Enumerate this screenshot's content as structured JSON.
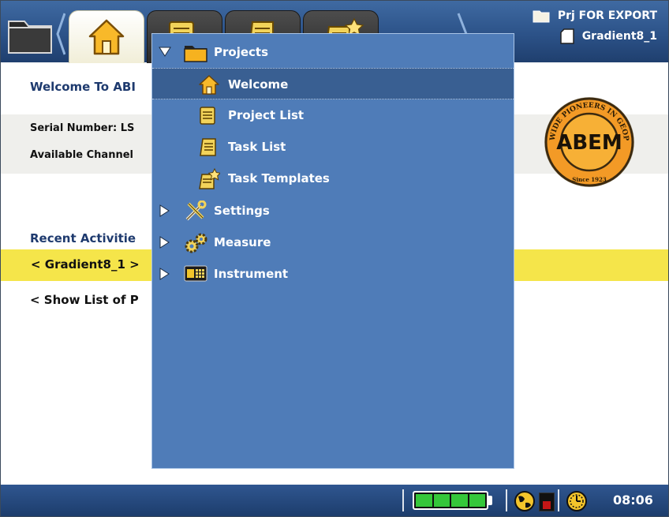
{
  "header": {
    "project_name": "Prj FOR EXPORT",
    "task_name": "Gradient8_1",
    "tabs": [
      "home-icon",
      "project-list-icon",
      "task-list-icon",
      "task-templates-icon"
    ]
  },
  "main": {
    "welcome_title": "Welcome To ABI",
    "serial_label": "Serial Number: LS",
    "channels_label": "Available Channel",
    "recent_title": "Recent Activitie",
    "recent_item": "< Gradient8_1 >",
    "show_list": "< Show List of P"
  },
  "menu": {
    "items": [
      {
        "label": "Projects",
        "icon": "folder-icon",
        "expanded": true
      },
      {
        "label": "Welcome",
        "icon": "home-icon",
        "selected": true
      },
      {
        "label": "Project List",
        "icon": "project-list-icon"
      },
      {
        "label": "Task List",
        "icon": "task-list-icon"
      },
      {
        "label": "Task Templates",
        "icon": "task-templates-icon"
      },
      {
        "label": "Settings",
        "icon": "tools-icon",
        "expanded": false
      },
      {
        "label": "Measure",
        "icon": "gears-icon",
        "expanded": false
      },
      {
        "label": "Instrument",
        "icon": "instrument-icon",
        "expanded": false
      }
    ]
  },
  "logo": {
    "brand": "ABEM",
    "ring_text": "WORLDWIDE PIONEERS IN GEOPHYSICS",
    "since": "Since 1923"
  },
  "status": {
    "time": "08:06",
    "battery_level": 1.0
  },
  "colors": {
    "menu_bg": "#4f7cb8",
    "menu_selected": "#395f92",
    "header_bg": "#2c5288",
    "highlight_yellow": "#f5e54a",
    "title_blue": "#1e3a6e"
  }
}
